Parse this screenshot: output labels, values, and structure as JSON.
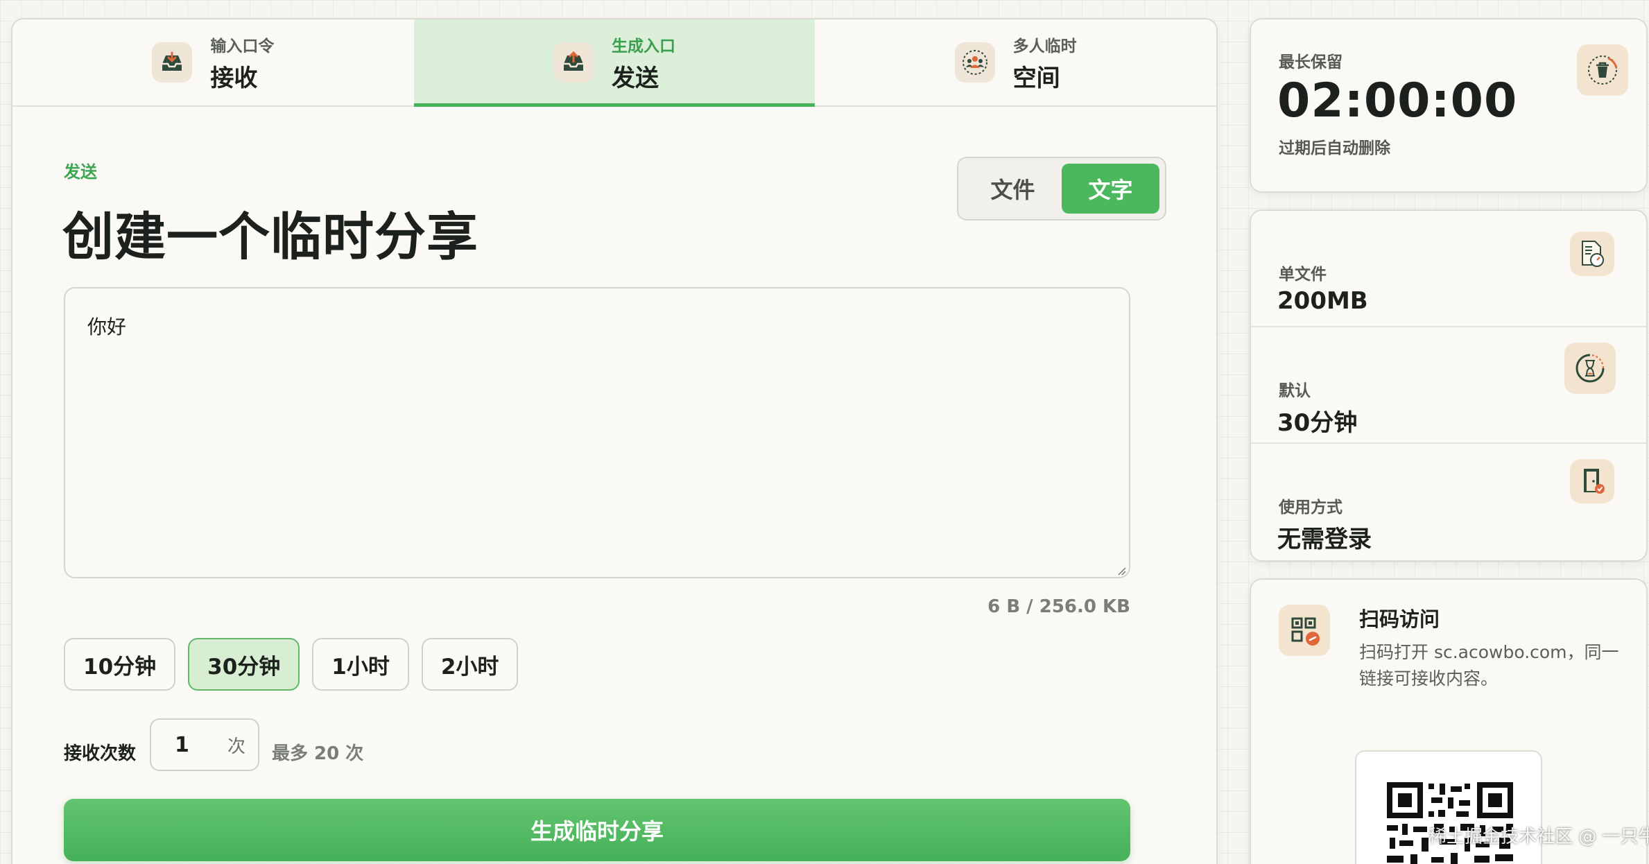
{
  "tabs": [
    {
      "sub": "输入口令",
      "title": "接收",
      "icon": "inbox-download-icon"
    },
    {
      "sub": "生成入口",
      "title": "发送",
      "icon": "inbox-upload-icon"
    },
    {
      "sub": "多人临时",
      "title": "空间",
      "icon": "group-people-icon"
    }
  ],
  "active_tab": 1,
  "form": {
    "eyebrow": "发送",
    "title": "创建一个临时分享",
    "mode_file": "文件",
    "mode_text": "文字",
    "active_mode": "文字",
    "text_value": "你好",
    "counter": "6 B / 256.0 KB",
    "durations": [
      "10分钟",
      "30分钟",
      "1小时",
      "2小时"
    ],
    "active_duration": "30分钟",
    "count_label": "接收次数",
    "count_value": "1",
    "count_unit": "次",
    "count_max": "最多 20 次",
    "submit_label": "生成临时分享"
  },
  "retention": {
    "label": "最长保留",
    "timer": "02:00:00",
    "hint": "过期后自动删除",
    "icon": "trash-timer-icon"
  },
  "limits": [
    {
      "label": "单文件",
      "value": "200MB",
      "icon": "file-gauge-icon"
    },
    {
      "label": "默认",
      "value": "30分钟",
      "icon": "hourglass-icon"
    },
    {
      "label": "使用方式",
      "value": "无需登录",
      "icon": "door-check-icon"
    }
  ],
  "qr": {
    "title": "扫码访问",
    "desc": "扫码打开 sc.acowbo.com，同一链接可接收内容。",
    "icon": "qr-link-icon"
  },
  "watermark": "稀土掘金技术社区 @ 一只牛博",
  "colors": {
    "accent": "#44b35a",
    "accent_light": "#dcefd8",
    "icon_bg": "#f3e4cf",
    "icon_orange": "#e0673a"
  }
}
